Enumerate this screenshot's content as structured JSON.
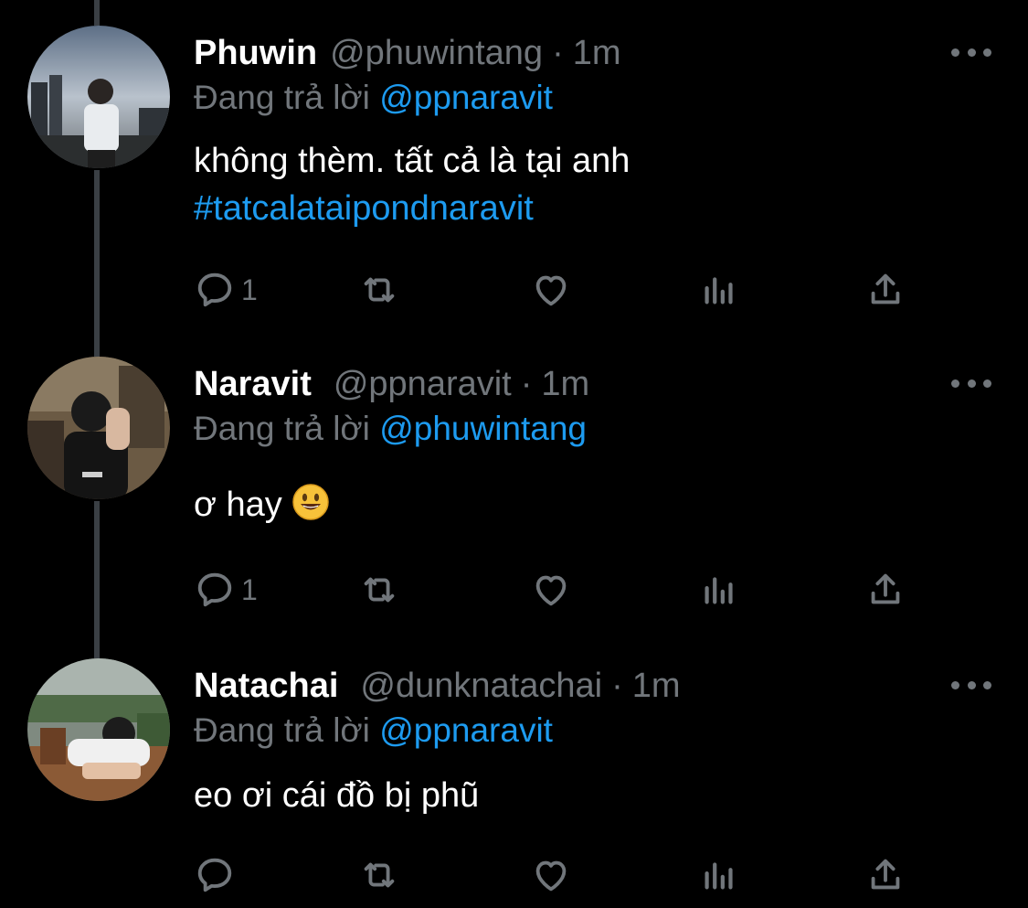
{
  "colors": {
    "background": "#000000",
    "text": "#ffffff",
    "muted": "#71767b",
    "link": "#1d9bf0",
    "thread_line": "#3a3f44"
  },
  "reply_prefix": "Đang trả lời",
  "tweets": [
    {
      "name": "Phuwin",
      "handle": "@phuwintang",
      "time": "1m",
      "reply_to": "@ppnaravit",
      "text": "không thèm. tất cả là tại anh",
      "hashtag": "#tatcalataipondnaravit",
      "reply_count": "1"
    },
    {
      "name": "Naravit",
      "handle": "@ppnaravit",
      "time": "1m",
      "reply_to": "@phuwintang",
      "text": "ơ hay",
      "emoji": "smiling-face-icon",
      "reply_count": "1"
    },
    {
      "name": "Natachai",
      "handle": "@dunknatachai",
      "time": "1m",
      "reply_to": "@ppnaravit",
      "text": "eo ơi cái đồ bị phũ",
      "reply_count": ""
    }
  ],
  "icons": {
    "reply": "reply-icon",
    "retweet": "retweet-icon",
    "like": "heart-icon",
    "analytics": "analytics-icon",
    "share": "share-icon",
    "more": "more-icon"
  }
}
